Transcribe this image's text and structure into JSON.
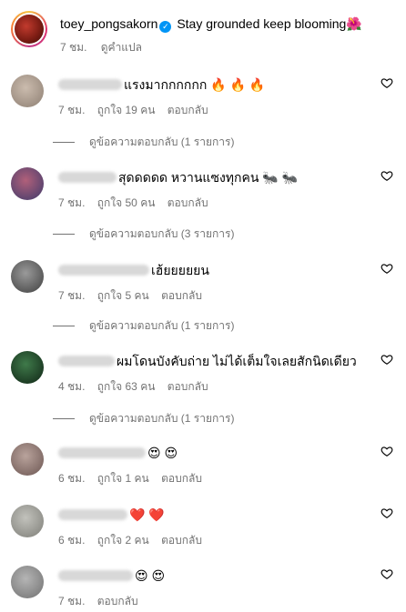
{
  "caption": {
    "username": "toey_pongsakorn",
    "text": "Stay grounded keep blooming",
    "emoji": "🌺",
    "time": "7 ชม.",
    "translate": "ดูคำแปล"
  },
  "comments": [
    {
      "text": "แรงมากกกกกก",
      "emoji": "🔥 🔥 🔥",
      "time": "7 ชม.",
      "likes": "ถูกใจ 19 คน",
      "reply": "ตอบกลับ",
      "replies": "ดูข้อความตอบกลับ (1 รายการ)",
      "avatar_color": "#b8a89a"
    },
    {
      "text": "สุดดดดด หวานแซงทุกคน",
      "emoji": "🐜 🐜",
      "time": "7 ชม.",
      "likes": "ถูกใจ 50 คน",
      "reply": "ตอบกลับ",
      "replies": "ดูข้อความตอบกลับ (3 รายการ)",
      "avatar_color": "#7a6f8c"
    },
    {
      "text": "เฮ้ยยยยยน",
      "emoji": "",
      "time": "7 ชม.",
      "likes": "ถูกใจ 5 คน",
      "reply": "ตอบกลับ",
      "replies": "ดูข้อความตอบกลับ (1 รายการ)",
      "avatar_color": "#6d6d6d"
    },
    {
      "text": "ผมโดนบังคับถ่าย ไม่ได้เต็มใจเลยสักนิดเดียว",
      "emoji": "",
      "time": "4 ชม.",
      "likes": "ถูกใจ 63 คน",
      "reply": "ตอบกลับ",
      "replies": "ดูข้อความตอบกลับ (1 รายการ)",
      "avatar_color": "#2f4a34"
    },
    {
      "text": "",
      "emoji": "😍 😍",
      "time": "6 ชม.",
      "likes": "ถูกใจ 1 คน",
      "reply": "ตอบกลับ",
      "replies": "",
      "avatar_color": "#a08f8a"
    },
    {
      "text": "",
      "emoji": "❤️ ❤️",
      "time": "6 ชม.",
      "likes": "ถูกใจ 2 คน",
      "reply": "ตอบกลับ",
      "replies": "",
      "avatar_color": "#9a9a95"
    },
    {
      "text": "",
      "emoji": "😍 😍",
      "time": "7 ชม.",
      "likes": "",
      "reply": "ตอบกลับ",
      "replies": "",
      "avatar_color": "#8f8f8f"
    }
  ]
}
